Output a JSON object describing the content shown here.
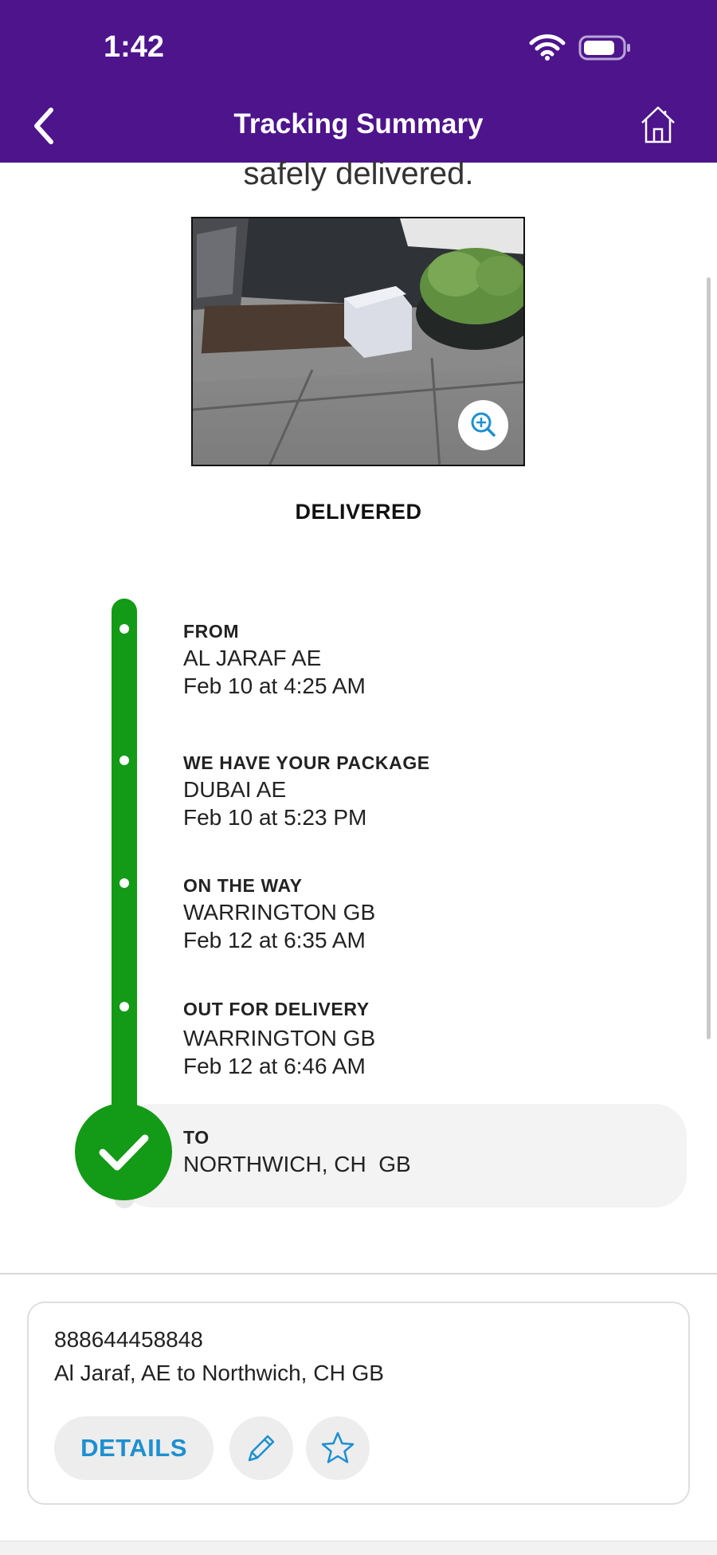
{
  "status_bar": {
    "time": "1:42"
  },
  "header": {
    "title": "Tracking Summary"
  },
  "content": {
    "intro_text": "safely delivered.",
    "status": "DELIVERED"
  },
  "timeline": [
    {
      "title": "FROM",
      "line1": "AL JARAF AE",
      "line2": "Feb 10 at 4:25 AM"
    },
    {
      "title": "WE HAVE YOUR PACKAGE",
      "line1": "DUBAI AE",
      "line2": "Feb 10 at 5:23 PM"
    },
    {
      "title": "ON THE WAY",
      "line1": "WARRINGTON GB",
      "line2": "Feb 12 at 6:35 AM"
    },
    {
      "title": "OUT FOR DELIVERY",
      "line1": "WARRINGTON GB",
      "line2": "Feb 12 at 6:46 AM"
    },
    {
      "title": "TO",
      "line1": "NORTHWICH, CH  GB"
    }
  ],
  "card": {
    "tracking_number": "888644458848",
    "route": "Al Jaraf, AE to Northwich, CH GB",
    "details_label": "DETAILS"
  },
  "colors": {
    "brand_purple": "#4d148c",
    "timeline_green": "#139a16",
    "link_blue": "#1d8fd0"
  },
  "icons": {
    "back": "chevron-left-icon",
    "home": "home-icon",
    "zoom": "zoom-in-icon",
    "check": "checkmark-icon",
    "edit": "pencil-icon",
    "favorite": "star-icon"
  }
}
